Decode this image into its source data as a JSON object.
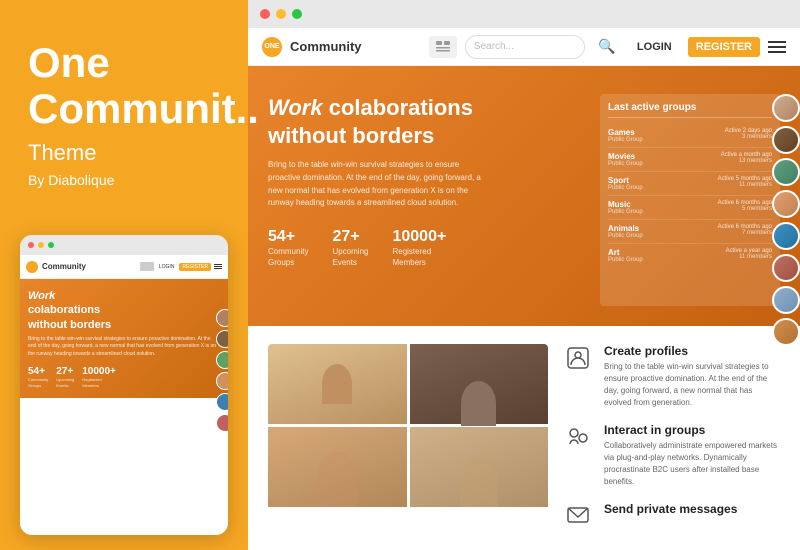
{
  "brand": {
    "title": "One",
    "subtitle": "Communit..",
    "theme_label": "Theme",
    "by_label": "By Diabolique"
  },
  "browser_dots": [
    "red",
    "yellow",
    "green"
  ],
  "site_nav": {
    "logo_letter": "ONE",
    "logo_text": "Community",
    "search_placeholder": "Search...",
    "login_label": "LOGIN",
    "register_label": "REGISTER",
    "search_icon": "🔍"
  },
  "hero": {
    "title_work": "Work",
    "title_rest": "colaborations\nwithout borders",
    "description": "Bring to the table win-win survival strategies to ensure proactive domination. At the end of the day, going forward, a new normal that has evolved from generation X is on the runway heading towards a streamlined cloud solution.",
    "stats": [
      {
        "number": "54+",
        "label": "Community\nGroups"
      },
      {
        "number": "27+",
        "label": "Upcoming\nEvents"
      },
      {
        "number": "10000+",
        "label": "Registered\nMembers"
      }
    ]
  },
  "groups_panel": {
    "title": "Last active groups",
    "groups": [
      {
        "name": "Games",
        "type": "Public Group",
        "active": "Active 2 days ago",
        "members": "3 members"
      },
      {
        "name": "Movies",
        "type": "Public Group",
        "active": "Active a month ago",
        "members": "13 members"
      },
      {
        "name": "Sport",
        "type": "Public Group",
        "active": "Active 5 months ago",
        "members": "11 members"
      },
      {
        "name": "Music",
        "type": "Public Group",
        "active": "Active 6 months ago",
        "members": "5 members"
      },
      {
        "name": "Animals",
        "type": "Public Group",
        "active": "Active 6 months ago",
        "members": "7 members"
      },
      {
        "name": "Art",
        "type": "Public Group",
        "active": "Active a year ago",
        "members": "11 members"
      }
    ]
  },
  "features": [
    {
      "icon": "profile",
      "title": "Create profiles",
      "description": "Bring to the table win-win survival strategies to ensure proactive domination. At the end of the day, going forward, a new normal that has evolved from generation."
    },
    {
      "icon": "interact",
      "title": "Interact in groups",
      "description": "Collaboratively administrate empowered markets via plug-and-play networks. Dynamically procrastinate B2C users after installed base benefits."
    },
    {
      "icon": "message",
      "title": "Send private messages",
      "description": ""
    }
  ],
  "colors": {
    "orange": "#F5A623",
    "dark_orange": "#e8842a"
  }
}
